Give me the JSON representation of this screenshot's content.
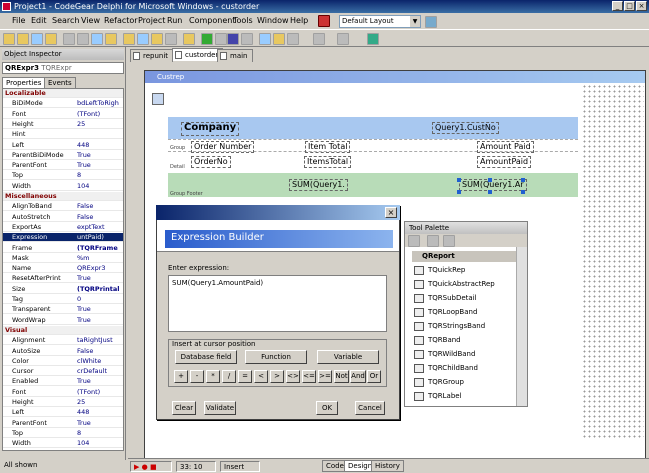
{
  "window": {
    "title": "Project1 - CodeGear Delphi for Microsoft Windows - custorder",
    "min": "_",
    "max": "□",
    "close": "×"
  },
  "menu": [
    "File",
    "Edit",
    "Search",
    "View",
    "Refactor",
    "Project",
    "Run",
    "Component",
    "Tools",
    "Window",
    "Help"
  ],
  "layout_select": "Default Layout",
  "inspector": {
    "title": "Object Inspector",
    "component": "QRExpr3",
    "component_type": "TQRExpr",
    "tabs": [
      "Properties",
      "Events"
    ],
    "rows": [
      {
        "n": "Localizable",
        "v": "",
        "t": "cat"
      },
      {
        "n": "BiDiMode",
        "v": "bdLeftToRigh",
        "t": ""
      },
      {
        "n": "Font",
        "v": "(TFont)",
        "t": ""
      },
      {
        "n": "Height",
        "v": "25",
        "t": ""
      },
      {
        "n": "Hint",
        "v": "",
        "t": ""
      },
      {
        "n": "Left",
        "v": "448",
        "t": ""
      },
      {
        "n": "ParentBiDiMode",
        "v": "True",
        "t": ""
      },
      {
        "n": "ParentFont",
        "v": "True",
        "t": ""
      },
      {
        "n": "Top",
        "v": "8",
        "t": ""
      },
      {
        "n": "Width",
        "v": "104",
        "t": ""
      },
      {
        "n": "Miscellaneous",
        "v": "",
        "t": "cat"
      },
      {
        "n": "AlignToBand",
        "v": "False",
        "t": ""
      },
      {
        "n": "AutoStretch",
        "v": "False",
        "t": ""
      },
      {
        "n": "ExportAs",
        "v": "exptText",
        "t": ""
      },
      {
        "n": "Expression",
        "v": "untPaid)",
        "t": "sel"
      },
      {
        "n": "Frame",
        "v": "(TQRFrame",
        "t": "b"
      },
      {
        "n": "Mask",
        "v": "%m",
        "t": ""
      },
      {
        "n": "Name",
        "v": "QRExpr3",
        "t": ""
      },
      {
        "n": "ResetAfterPrint",
        "v": "True",
        "t": ""
      },
      {
        "n": "Size",
        "v": "(TQRPrintal",
        "t": "b"
      },
      {
        "n": "Tag",
        "v": "0",
        "t": ""
      },
      {
        "n": "Transparent",
        "v": "True",
        "t": ""
      },
      {
        "n": "WordWrap",
        "v": "True",
        "t": ""
      },
      {
        "n": "Visual",
        "v": "",
        "t": "cat"
      },
      {
        "n": "Alignment",
        "v": "taRightJust",
        "t": ""
      },
      {
        "n": "AutoSize",
        "v": "False",
        "t": ""
      },
      {
        "n": "Color",
        "v": "clWhite",
        "t": ""
      },
      {
        "n": "Cursor",
        "v": "crDefault",
        "t": ""
      },
      {
        "n": "Enabled",
        "v": "True",
        "t": ""
      },
      {
        "n": "Font",
        "v": "(TFont)",
        "t": ""
      },
      {
        "n": "Height",
        "v": "25",
        "t": ""
      },
      {
        "n": "Left",
        "v": "448",
        "t": ""
      },
      {
        "n": "ParentFont",
        "v": "True",
        "t": ""
      },
      {
        "n": "Top",
        "v": "8",
        "t": ""
      },
      {
        "n": "Width",
        "v": "104",
        "t": ""
      }
    ],
    "status": "All shown"
  },
  "editor_tabs": [
    "repunit",
    "custorder",
    "main"
  ],
  "report": {
    "title": "Custrep",
    "company": "Company",
    "custno": "Query1.CustNo",
    "col_order": "Order Number",
    "col_items": "Item Total",
    "col_paid": "Amount Paid",
    "f_order": "OrderNo",
    "f_items": "ItemsTotal",
    "f_paid": "AmountPaid",
    "sum1": "SUM(Query1.",
    "sum2": "SUM(Query1.Ar",
    "band_group": "Group",
    "band_detail": "Detail",
    "band_footer": "Group Footer"
  },
  "expression_builder": {
    "heading": "Expression Builder",
    "enter_label": "Enter expression:",
    "expression": "SUM(Query1.AmountPaid)",
    "insert_label": "Insert at cursor position",
    "database_field": "Database field",
    "function": "Function",
    "variable": "Variable",
    "operators": [
      "+",
      "-",
      "*",
      "/",
      "=",
      "<",
      ">",
      "<>",
      "<=",
      ">=",
      "Not",
      "And",
      "Or"
    ],
    "clear": "Clear",
    "validate": "Validate",
    "ok": "OK",
    "cancel": "Cancel",
    "close": "×"
  },
  "tool_palette": {
    "title": "Tool Palette",
    "category": "QReport",
    "items": [
      "TQuickRep",
      "TQuickAbstractRep",
      "TQRSubDetail",
      "TQRLoopBand",
      "TQRStringsBand",
      "TQRBand",
      "TQRWildBand",
      "TQRChildBand",
      "TQRGroup",
      "TQRLabel"
    ]
  },
  "statusbar": {
    "position": "33: 10",
    "mode": "Insert",
    "tabs": [
      "Code",
      "Design",
      "History"
    ]
  }
}
